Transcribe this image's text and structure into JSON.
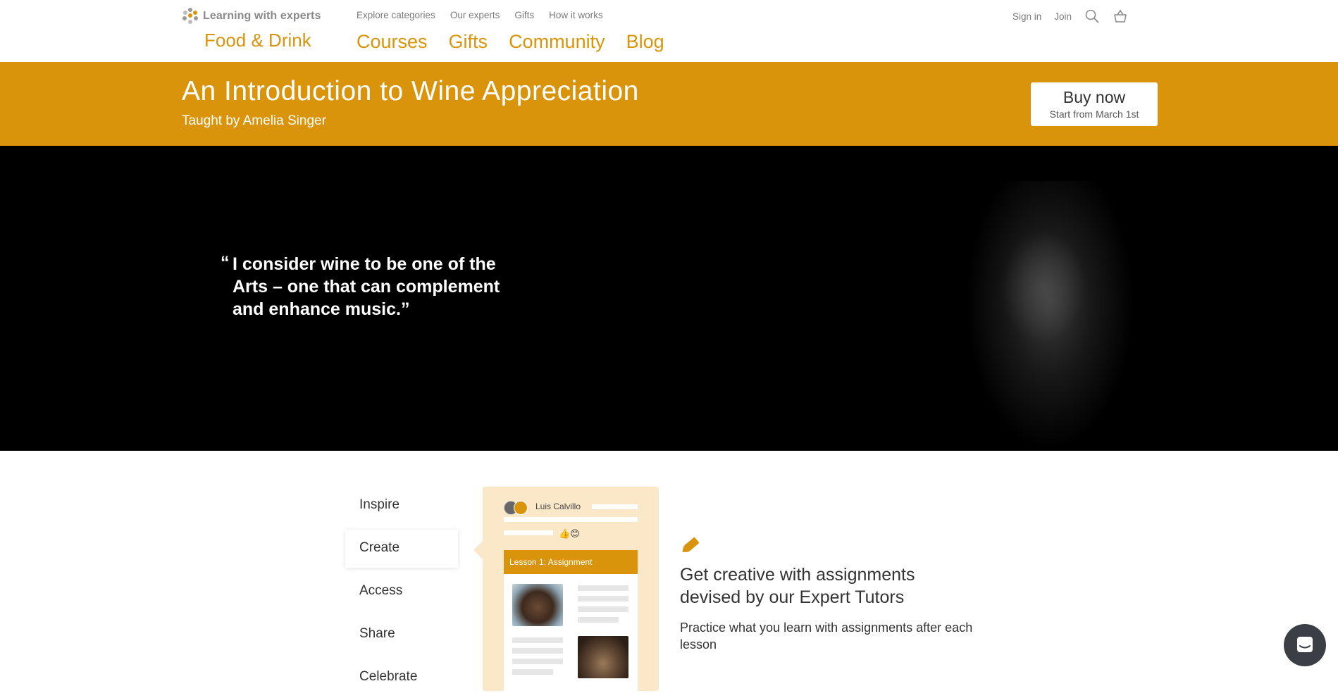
{
  "header": {
    "logo_text": "Learning with experts",
    "section_name": "Food & Drink",
    "top_nav": [
      "Explore categories",
      "Our experts",
      "Gifts",
      "How it works"
    ],
    "main_nav": [
      "Courses",
      "Gifts",
      "Community",
      "Blog"
    ],
    "account": {
      "sign_in": "Sign in",
      "join": "Join"
    },
    "icons": [
      "search-icon",
      "basket-icon"
    ]
  },
  "course": {
    "title": "An Introduction to Wine Appreciation",
    "tutor": "Taught by Amelia Singer",
    "buy_label": "Buy now",
    "buy_sub": "Start from March 1st"
  },
  "hero": {
    "quote_mark": "“",
    "quote": "I consider wine to be one of the Arts – one that can complement and enhance music.”"
  },
  "features": {
    "tabs": [
      "Inspire",
      "Create",
      "Access",
      "Share",
      "Celebrate"
    ],
    "active_tab": "Create",
    "preview": {
      "user_name": "Luis Calvillo",
      "reactions": "👍😊",
      "card_title": "Lesson 1: Assignment"
    },
    "title": "Get creative with assignments devised by our Expert Tutors",
    "text": "Practice what you learn with assignments after each lesson"
  },
  "colors": {
    "brand": "#d9940b",
    "panel": "#fae8c8",
    "hero_bg": "#000000"
  }
}
